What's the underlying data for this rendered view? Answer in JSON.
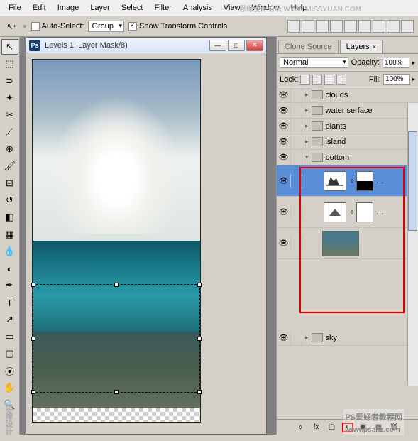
{
  "menu": {
    "file": "File",
    "edit": "Edit",
    "image": "Image",
    "layer": "Layer",
    "select": "Select",
    "filter": "Filter",
    "analysis": "Analysis",
    "view": "View",
    "window": "Window",
    "help": "Help"
  },
  "options": {
    "auto_select_label": "Auto-Select:",
    "group": "Group",
    "show_transform": "Show Transform Controls"
  },
  "doc": {
    "title": "Levels 1, Layer Mask/8)"
  },
  "window_buttons": {
    "min": "—",
    "max": "□",
    "close": "✕"
  },
  "panels": {
    "tab_clone": "Clone Source",
    "tab_layers": "Layers",
    "blend_mode": "Normal",
    "opacity_label": "Opacity:",
    "opacity_value": "100%",
    "lock_label": "Lock:",
    "fill_label": "Fill:",
    "fill_value": "100%"
  },
  "layers": {
    "clouds": "clouds",
    "water": "water serface",
    "plants": "plants",
    "island": "island",
    "bottom": "bottom",
    "sky": "sky"
  },
  "tools": {
    "move": "↖",
    "marquee": "⬚",
    "lasso": "⊃",
    "wand": "✦",
    "crop": "✂",
    "slice": "⟋",
    "heal": "⊕",
    "brush": "🖌",
    "stamp": "⊟",
    "history": "↺",
    "eraser": "◧",
    "gradient": "▦",
    "blur": "💧",
    "dodge": "◐",
    "pen": "✒",
    "type": "T",
    "path": "↗",
    "shape": "▭",
    "notes": "▢",
    "eyedrop": "⦿",
    "hand": "✋",
    "zoom": "🔍"
  },
  "icons": {
    "eye": "👁",
    "link": "🔗",
    "fx": "fx",
    "mask": "▢",
    "adj": "◐",
    "group": "▣",
    "new": "▦",
    "trash": "🗑",
    "levels": "▲",
    "ps": "Ps",
    "arrow": "▸",
    "arrowdown": "▾",
    "dots": "…"
  },
  "watermarks": {
    "top": "思缘设计论坛 WWW.MISSYUAN.COM",
    "bottom": "PS爱好者教程网",
    "url": "www.psahz.com",
    "left": "思缘设计"
  }
}
